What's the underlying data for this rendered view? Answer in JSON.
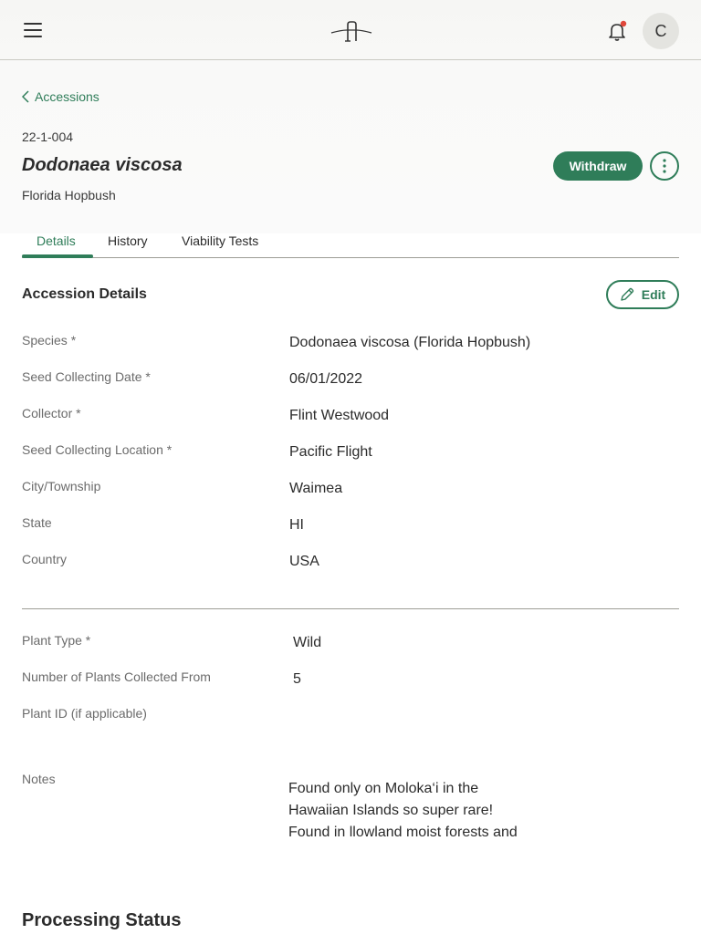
{
  "topbar": {
    "avatar_initial": "C",
    "notification_dot_color": "#e0473a"
  },
  "header": {
    "breadcrumb_label": "Accessions",
    "accession_number": "22-1-004",
    "species_title": "Dodonaea viscosa",
    "common_name": "Florida Hopbush",
    "withdraw_label": "Withdraw"
  },
  "tabs": [
    {
      "label": "Details",
      "active": true
    },
    {
      "label": "History",
      "active": false
    },
    {
      "label": "Viability Tests",
      "active": false
    }
  ],
  "details": {
    "title": "Accession Details",
    "edit_label": "Edit",
    "fields": [
      {
        "label": "Species *",
        "value": "Dodonaea viscosa (Florida Hopbush)"
      },
      {
        "label": "Seed Collecting Date *",
        "value": "06/01/2022"
      },
      {
        "label": "Collector *",
        "value": "Flint Westwood"
      },
      {
        "label": "Seed Collecting Location *",
        "value": "Pacific Flight"
      },
      {
        "label": "City/Township",
        "value": "Waimea"
      },
      {
        "label": "State",
        "value": "HI"
      },
      {
        "label": "Country",
        "value": "USA"
      }
    ],
    "plant_fields": [
      {
        "label": "Plant Type *",
        "value": "Wild"
      },
      {
        "label": "Number of Plants Collected From",
        "value": "5"
      },
      {
        "label": "Plant ID (if applicable)",
        "value": ""
      }
    ],
    "notes_label": "Notes",
    "notes_lines": [
      "Found only on Moloka‘i in the",
      "Hawaiian Islands so super rare!",
      "Found in llowland moist forests and"
    ]
  },
  "processing": {
    "title": "Processing Status"
  },
  "colors": {
    "accent": "#2f7d59"
  }
}
